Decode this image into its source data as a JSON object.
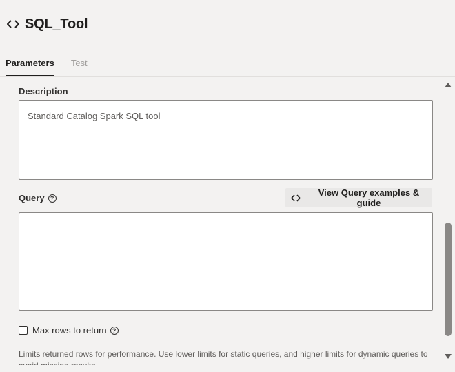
{
  "header": {
    "title": "SQL_Tool",
    "tabs": [
      {
        "label": "Parameters",
        "active": true
      },
      {
        "label": "Test",
        "active": false
      }
    ]
  },
  "description": {
    "label": "Description",
    "value": "Standard Catalog Spark SQL tool"
  },
  "query": {
    "label": "Query",
    "value": "",
    "guide_button_label": "View Query examples & guide"
  },
  "max_rows": {
    "label": "Max rows to return",
    "checked": false,
    "note": "Limits returned rows for performance. Use lower limits for static queries, and higher limits for dynamic queries to avoid missing results."
  },
  "icons": {
    "title_icon": "code-icon",
    "help_icon": "help-circle-icon",
    "scroll_up": "scroll-up-arrow-icon",
    "scroll_down": "scroll-down-arrow-icon"
  },
  "colors": {
    "background": "#f3f2f1",
    "field_border": "#8a8886",
    "text": "#201f1e",
    "muted_text": "#a19f9d"
  }
}
